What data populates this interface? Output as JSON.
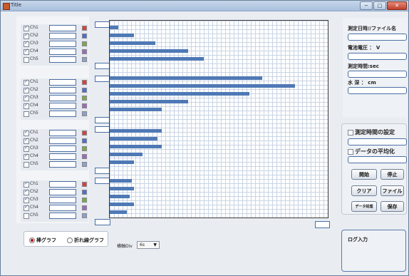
{
  "window": {
    "title": "Title"
  },
  "window_buttons": {
    "minimize": "−",
    "maximize": "□",
    "close": "✕"
  },
  "colors": {
    "bar": "#4f79b5",
    "grid": "#c8d4e4",
    "swatches": [
      "#d94040",
      "#4a6fd0",
      "#7aaa4a",
      "#9a6bc0",
      "#8aa0d0"
    ]
  },
  "groups": [
    {
      "channels": [
        {
          "label": "Ch1",
          "checked": true
        },
        {
          "label": "Ch2",
          "checked": true
        },
        {
          "label": "Ch3",
          "checked": true
        },
        {
          "label": "Ch4",
          "checked": true
        },
        {
          "label": "Ch5",
          "checked": false
        }
      ]
    },
    {
      "channels": [
        {
          "label": "Ch1",
          "checked": true
        },
        {
          "label": "Ch2",
          "checked": true
        },
        {
          "label": "Ch3",
          "checked": true
        },
        {
          "label": "Ch4",
          "checked": true
        },
        {
          "label": "Ch5",
          "checked": false
        }
      ]
    },
    {
      "channels": [
        {
          "label": "Ch1",
          "checked": true
        },
        {
          "label": "Ch2",
          "checked": true
        },
        {
          "label": "Ch3",
          "checked": true
        },
        {
          "label": "Ch4",
          "checked": true
        },
        {
          "label": "Ch5",
          "checked": false
        }
      ]
    },
    {
      "channels": [
        {
          "label": "Ch1",
          "checked": true
        },
        {
          "label": "Ch2",
          "checked": true
        },
        {
          "label": "Ch3",
          "checked": true
        },
        {
          "label": "Ch4",
          "checked": true
        },
        {
          "label": "Ch5",
          "checked": false
        }
      ]
    }
  ],
  "chart_data": {
    "type": "bar",
    "orientation": "horizontal",
    "grid": true,
    "groups": [
      {
        "values": [
          0.04,
          0.11,
          0.21,
          0.36,
          0.43
        ]
      },
      {
        "values": [
          0.7,
          0.85,
          0.64,
          0.36,
          0.24
        ]
      },
      {
        "values": [
          0.24,
          0.22,
          0.24,
          0.15,
          0.11
        ]
      },
      {
        "values": [
          0.1,
          0.11,
          0.09,
          0.11,
          0.08
        ]
      }
    ]
  },
  "right_panel": {
    "datetime_label": "測定日時//ファイル名",
    "voltage_label": "電池電圧 ： V",
    "time_label": "測定時間:sec",
    "depth_label": "水 深 ： cm"
  },
  "controls": {
    "measure_time_setting": "測定時間の設定",
    "data_averaging": "データの平均化",
    "start_button": "開始",
    "stop_button": "停止",
    "clear_button": "クリア",
    "file_button": "ファイル",
    "process_button": "データ処理",
    "save_button": "保存"
  },
  "mode": {
    "bar_graph": "棒グラフ",
    "line_graph": "折れ線グラフ",
    "selected": "bar_graph"
  },
  "display_select": {
    "label": "横軸Div",
    "value": "6s"
  },
  "log": {
    "label": "ログ入力"
  }
}
